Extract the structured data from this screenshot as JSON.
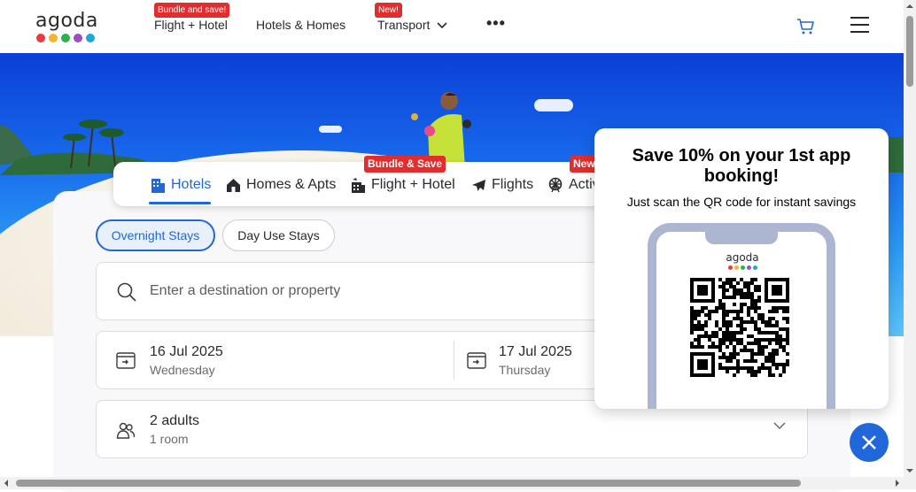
{
  "brand": {
    "logo_text": "agoda",
    "dot_colors": [
      "#ea3a3a",
      "#f7b32b",
      "#2bb24c",
      "#9b4fc0",
      "#1ba6de"
    ]
  },
  "nav": {
    "items": [
      {
        "label": "Flight + Hotel",
        "badge": "Bundle and save!"
      },
      {
        "label": "Hotels & Homes",
        "badge": ""
      },
      {
        "label": "Transport",
        "badge": "New!"
      }
    ],
    "more": "•••"
  },
  "search": {
    "tabs": [
      {
        "label": "Hotels",
        "icon": "hotel-icon",
        "active": true
      },
      {
        "label": "Homes & Apts",
        "icon": "home-icon"
      },
      {
        "label": "Flight + Hotel",
        "icon": "flight-hotel-icon",
        "badge": "Bundle & Save"
      },
      {
        "label": "Flights",
        "icon": "plane-icon"
      },
      {
        "label": "Activ",
        "icon": "ferris-wheel-icon",
        "badge": "New"
      }
    ],
    "stay_types": {
      "active": "Overnight Stays",
      "other": "Day Use Stays"
    },
    "destination_placeholder": "Enter a destination or property",
    "checkin": {
      "date": "16 Jul 2025",
      "day": "Wednesday"
    },
    "checkout": {
      "date": "17 Jul 2025",
      "day": "Thursday"
    },
    "guests": {
      "adults": "2 adults",
      "rooms": "1 room"
    }
  },
  "promo": {
    "title": "Save 10% on your 1st app booking!",
    "subtitle": "Just scan the QR code for instant savings",
    "phone_logo": "agoda"
  },
  "colors": {
    "accent": "#2067da",
    "badge": "#e12d2d"
  }
}
